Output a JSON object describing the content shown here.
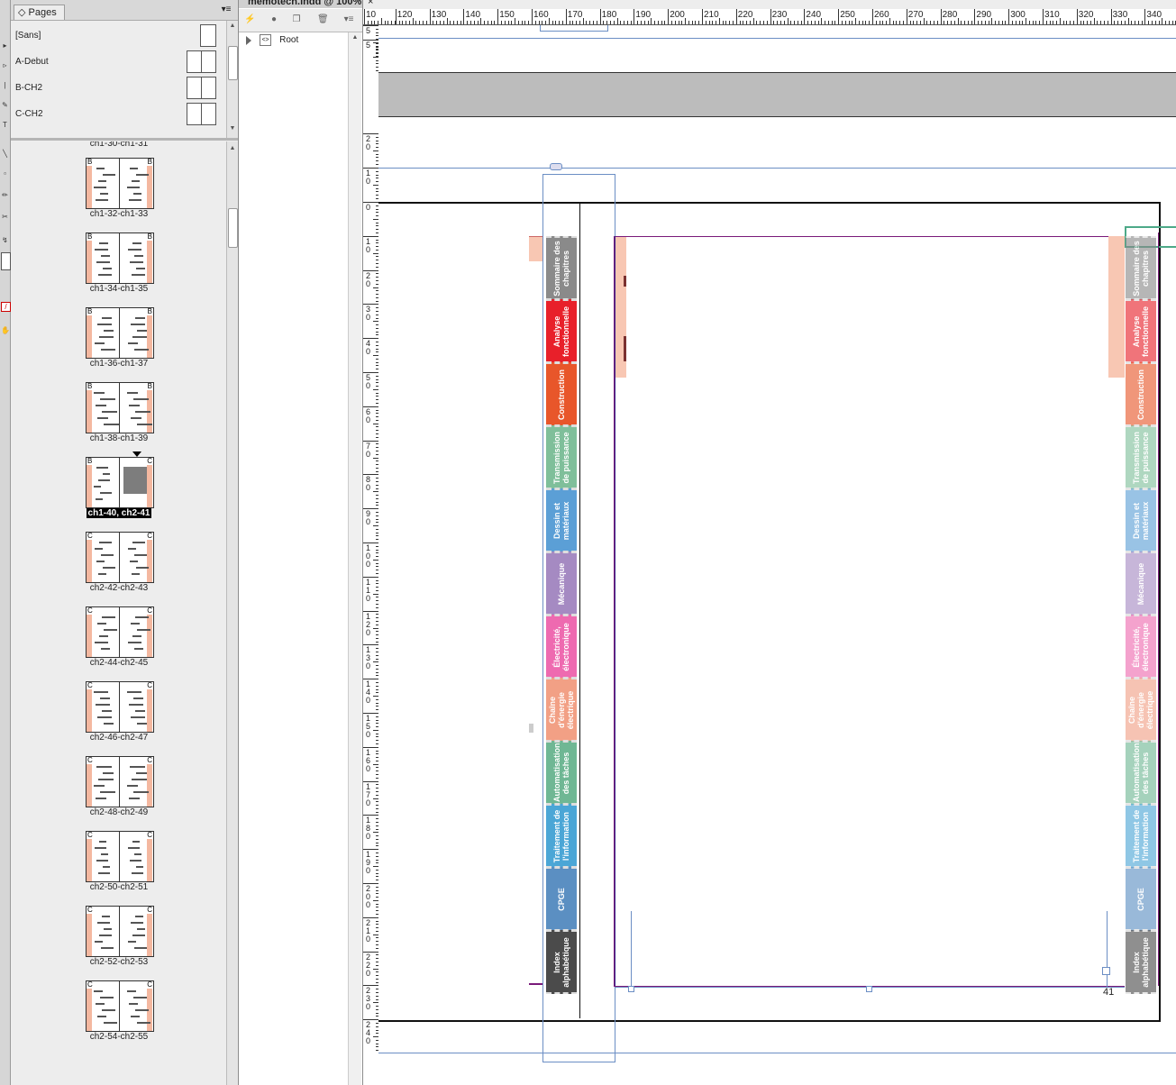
{
  "document": {
    "tab_title": "memotech.indd @ 100%",
    "close_symbol": "×"
  },
  "pages_panel": {
    "tab_label": "Pages",
    "tab_icon": "◇",
    "menu_icon": "hamburger-menu-icon",
    "masters": [
      {
        "label": "[Sans]",
        "pages": 1
      },
      {
        "label": "A-Debut",
        "pages": 2
      },
      {
        "label": "B-CH2",
        "pages": 2
      },
      {
        "label": "C-CH2",
        "pages": 2
      }
    ],
    "spreads": [
      {
        "label": "ch1-30-ch1-31",
        "left_letter": "",
        "right_letter": "",
        "selected": false
      },
      {
        "label": "ch1-32-ch1-33",
        "left_letter": "B",
        "right_letter": "B",
        "selected": false
      },
      {
        "label": "ch1-34-ch1-35",
        "left_letter": "B",
        "right_letter": "B",
        "selected": false
      },
      {
        "label": "ch1-36-ch1-37",
        "left_letter": "B",
        "right_letter": "B",
        "selected": false
      },
      {
        "label": "ch1-38-ch1-39",
        "left_letter": "B",
        "right_letter": "B",
        "selected": false
      },
      {
        "label": "ch1-40, ch2-41",
        "left_letter": "B",
        "right_letter": "C",
        "selected": true
      },
      {
        "label": "ch2-42-ch2-43",
        "left_letter": "C",
        "right_letter": "C",
        "selected": false
      },
      {
        "label": "ch2-44-ch2-45",
        "left_letter": "C",
        "right_letter": "C",
        "selected": false
      },
      {
        "label": "ch2-46-ch2-47",
        "left_letter": "C",
        "right_letter": "C",
        "selected": false
      },
      {
        "label": "ch2-48-ch2-49",
        "left_letter": "C",
        "right_letter": "C",
        "selected": false
      },
      {
        "label": "ch2-50-ch2-51",
        "left_letter": "C",
        "right_letter": "C",
        "selected": false
      },
      {
        "label": "ch2-52-ch2-53",
        "left_letter": "C",
        "right_letter": "C",
        "selected": false
      },
      {
        "label": "ch2-54-ch2-55",
        "left_letter": "C",
        "right_letter": "C",
        "selected": false
      }
    ]
  },
  "structure_panel": {
    "root_label": "Root",
    "toolbar_icons": [
      "lightning-icon",
      "circle-icon",
      "new-element-icon",
      "trash-icon",
      "panel-menu-icon"
    ]
  },
  "ruler": {
    "h_numbers": [
      "10",
      "120",
      "130",
      "140",
      "150",
      "160",
      "170",
      "180",
      "190",
      "200",
      "210",
      "220",
      "230",
      "240",
      "250",
      "260",
      "270",
      "280",
      "290",
      "300",
      "310",
      "320",
      "330",
      "340"
    ],
    "v_numbers": [
      "5",
      "5",
      "2|0",
      "1|0",
      "0",
      "1|0",
      "2|0",
      "3|0",
      "4|0",
      "5|0",
      "6|0",
      "7|0",
      "8|0",
      "9|0",
      "1|0|0",
      "1|1|0",
      "1|2|0",
      "1|3|0",
      "1|4|0",
      "1|5|0",
      "1|6|0",
      "1|7|0",
      "1|8|0",
      "1|9|0",
      "2|0|0",
      "2|1|0",
      "2|2|0",
      "2|3|0",
      "2|4|0"
    ]
  },
  "chapter_tabs": [
    {
      "label": "Sommaire des chapitres",
      "color": "#8a8a8a"
    },
    {
      "label": "Analyse fonctionnelle",
      "color": "#e8202a"
    },
    {
      "label": "Construction",
      "color": "#e8562a"
    },
    {
      "label": "Transmission de puissance",
      "color": "#7fbf9a"
    },
    {
      "label": "Dessin et matériaux",
      "color": "#5b9fd6"
    },
    {
      "label": "Mécanique",
      "color": "#a58ac2"
    },
    {
      "label": "Électricité, électronique",
      "color": "#ee6ab0"
    },
    {
      "label": "Chaîne d'énergie électrique",
      "color": "#f2a085"
    },
    {
      "label": "Automatisation des tâches",
      "color": "#6fb794"
    },
    {
      "label": "Traitement de l'information",
      "color": "#4ba6d6"
    },
    {
      "label": "CPGE",
      "color": "#5b8fc2"
    },
    {
      "label": "Index alphabétique",
      "color": "#4b4b4b"
    }
  ],
  "chapter_tabs_right_faded": true,
  "page_number": "41"
}
